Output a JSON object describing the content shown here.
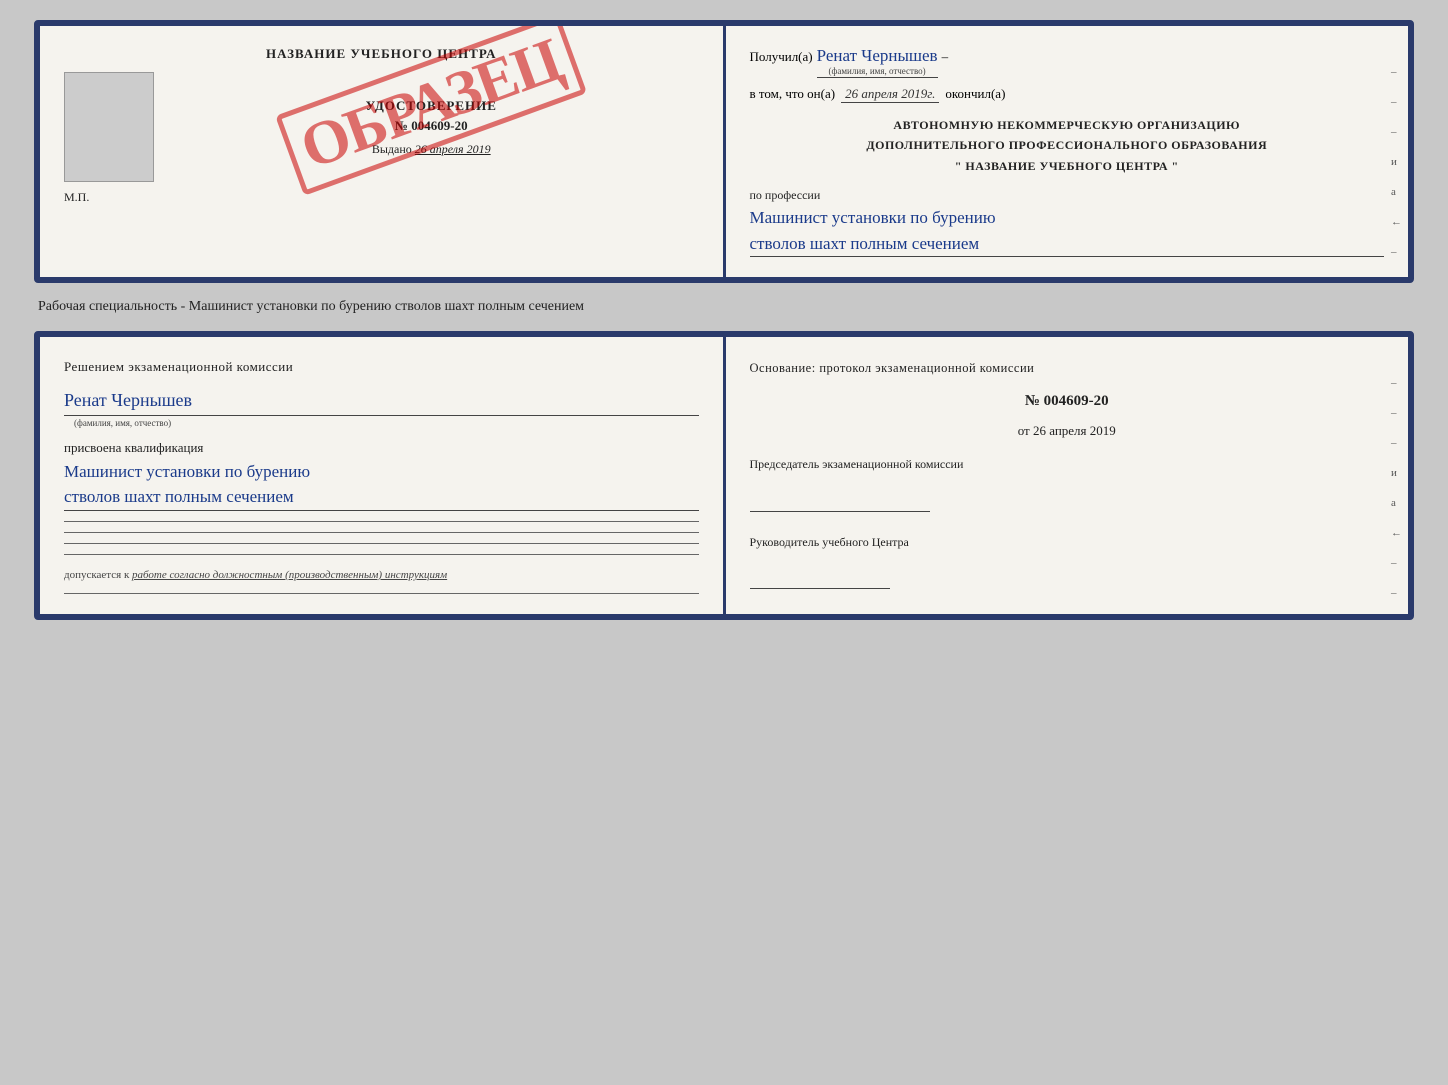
{
  "top_left": {
    "page_title": "НАЗВАНИЕ УЧЕБНОГО ЦЕНТРА",
    "udostoverenie_label": "УДОСТОВЕРЕНИЕ",
    "number": "№ 004609-20",
    "stamp": "ОБРАЗЕЦ",
    "vydano_label": "Выдано",
    "vydano_date": "26 апреля 2019",
    "mp": "М.П."
  },
  "top_right": {
    "poluchil_label": "Получил(а)",
    "fio_value": "Ренат Чернышев",
    "fio_hint": "(фамилия, имя, отчество)",
    "dash": "–",
    "vtom_label": "в том, что он(а)",
    "date_value": "26 апреля 2019г.",
    "okonchil_label": "окончил(а)",
    "org_line1": "АВТОНОМНУЮ НЕКОММЕРЧЕСКУЮ ОРГАНИЗАЦИЮ",
    "org_line2": "ДОПОЛНИТЕЛЬНОГО ПРОФЕССИОНАЛЬНОГО ОБРАЗОВАНИЯ",
    "org_line3": "\"   НАЗВАНИЕ УЧЕБНОГО ЦЕНТРА   \"",
    "po_professii_label": "по профессии",
    "profession_line1": "Машинист установки по бурению",
    "profession_line2": "стволов шахт полным сечением",
    "side_dashes": [
      "–",
      "–",
      "–",
      "и",
      "а",
      "←",
      "–",
      "–",
      "–"
    ]
  },
  "spec_label": "Рабочая специальность - Машинист установки по бурению стволов шахт полным сечением",
  "bottom_left": {
    "resheniem_label": "Решением экзаменационной комиссии",
    "fio_value": "Ренат Чернышев",
    "fio_hint": "(фамилия, имя, отчество)",
    "prisvoena_label": "присвоена квалификация",
    "qual_line1": "Машинист установки по бурению",
    "qual_line2": "стволов шахт полным сечением",
    "dopuskaetsya_label": "допускается к",
    "dopusk_text": "работе согласно должностным (производственным) инструкциям"
  },
  "bottom_right": {
    "osnovanie_label": "Основание: протокол экзаменационной комиссии",
    "number": "№  004609-20",
    "ot_label": "от",
    "ot_date": "26 апреля 2019",
    "predsedatel_label": "Председатель экзаменационной комиссии",
    "rukovoditel_label": "Руководитель учебного Центра",
    "side_dashes": [
      "–",
      "–",
      "–",
      "и",
      "а",
      "←",
      "–",
      "–",
      "–"
    ]
  }
}
